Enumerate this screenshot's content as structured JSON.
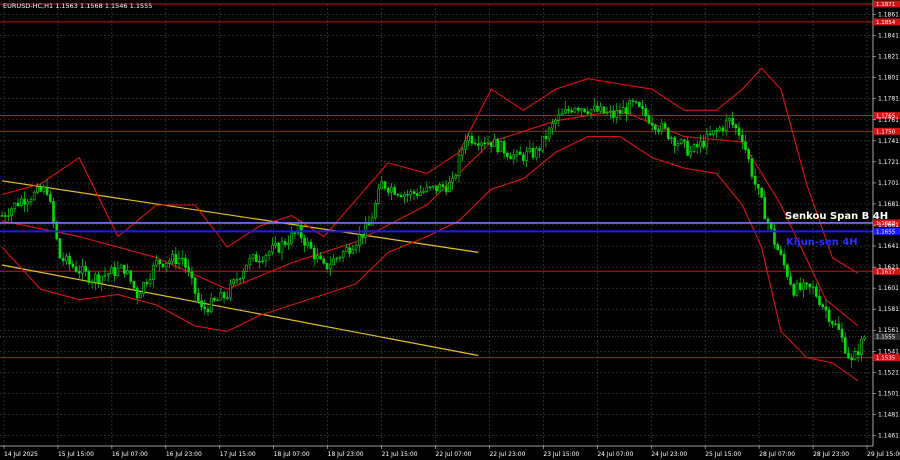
{
  "header": {
    "symbol_line": "EURUSD-HC,H1 1.1563 1.1568 1.1546 1.1555"
  },
  "annotations": {
    "senkou": "Senkou Span B 4H",
    "kijun": "Kijun-sen 4H"
  },
  "colors": {
    "background": "#000000",
    "grid": "#4a4a4a",
    "bull_candle": "#00e000",
    "bear_candle": "#00e000",
    "bollinger": "#e01010",
    "level_line": "#c01818",
    "channel": "#e8c020",
    "senkou": "#7a7aff",
    "kijun": "#1a1aff",
    "current_badge": "#303030"
  },
  "chart_data": {
    "type": "candlestick",
    "symbol": "EURUSD-HC",
    "timeframe": "H1",
    "ylim": [
      1.1451,
      1.1871
    ],
    "price_ticks": [
      "1.1861",
      "1.1841",
      "1.1821",
      "1.1801",
      "1.1781",
      "1.1761",
      "1.1741",
      "1.1721",
      "1.1701",
      "1.1681",
      "1.1661",
      "1.1641",
      "1.1621",
      "1.1601",
      "1.1581",
      "1.1561",
      "1.1541",
      "1.1521",
      "1.1501",
      "1.1481",
      "1.1461"
    ],
    "time_ticks": [
      "14 Jul 2025",
      "15 Jul 15:00",
      "16 Jul 07:00",
      "16 Jul 23:00",
      "17 Jul 15:00",
      "18 Jul 07:00",
      "18 Jul 23:00",
      "21 Jul 15:00",
      "22 Jul 07:00",
      "22 Jul 23:00",
      "23 Jul 15:00",
      "24 Jul 07:00",
      "24 Jul 23:00",
      "25 Jul 15:00",
      "28 Jul 07:00",
      "28 Jul 23:00",
      "29 Jul 15:00"
    ],
    "horizontal_levels": [
      {
        "price": 1.1871,
        "label": "1.1871"
      },
      {
        "price": 1.1854,
        "label": "1.1854"
      },
      {
        "price": 1.1765,
        "label": "1.1765"
      },
      {
        "price": 1.175,
        "label": "1.1750"
      },
      {
        "price": 1.1617,
        "label": "1.1617"
      },
      {
        "price": 1.1535,
        "label": "1.1535"
      }
    ],
    "senkou_span_b": {
      "price": 1.1663,
      "label": "1.1663"
    },
    "kijun_sen": {
      "price": 1.1655,
      "label": "1.1655"
    },
    "current_price": {
      "price": 1.1555,
      "label": "1.1555"
    },
    "channel_upper": [
      {
        "x": 0,
        "y": 1.1703
      },
      {
        "x": 148,
        "y": 1.1635
      }
    ],
    "channel_lower": [
      {
        "x": 0,
        "y": 1.1623
      },
      {
        "x": 148,
        "y": 1.1537
      }
    ],
    "close_path": [
      {
        "x": 0,
        "y": 1.167
      },
      {
        "x": 6,
        "y": 1.1685
      },
      {
        "x": 14,
        "y": 1.1695
      },
      {
        "x": 18,
        "y": 1.163
      },
      {
        "x": 28,
        "y": 1.161
      },
      {
        "x": 38,
        "y": 1.162
      },
      {
        "x": 42,
        "y": 1.1595
      },
      {
        "x": 48,
        "y": 1.1625
      },
      {
        "x": 56,
        "y": 1.163
      },
      {
        "x": 62,
        "y": 1.158
      },
      {
        "x": 70,
        "y": 1.1595
      },
      {
        "x": 76,
        "y": 1.1625
      },
      {
        "x": 86,
        "y": 1.164
      },
      {
        "x": 92,
        "y": 1.1655
      },
      {
        "x": 100,
        "y": 1.162
      },
      {
        "x": 108,
        "y": 1.164
      },
      {
        "x": 114,
        "y": 1.166
      },
      {
        "x": 118,
        "y": 1.17
      },
      {
        "x": 126,
        "y": 1.169
      },
      {
        "x": 134,
        "y": 1.1695
      },
      {
        "x": 140,
        "y": 1.17
      },
      {
        "x": 144,
        "y": 1.1745
      },
      {
        "x": 152,
        "y": 1.174
      },
      {
        "x": 160,
        "y": 1.1725
      },
      {
        "x": 166,
        "y": 1.173
      },
      {
        "x": 172,
        "y": 1.176
      },
      {
        "x": 178,
        "y": 1.1775
      },
      {
        "x": 184,
        "y": 1.177
      },
      {
        "x": 190,
        "y": 1.1765
      },
      {
        "x": 196,
        "y": 1.1775
      },
      {
        "x": 202,
        "y": 1.176
      },
      {
        "x": 208,
        "y": 1.1745
      },
      {
        "x": 214,
        "y": 1.173
      },
      {
        "x": 220,
        "y": 1.1745
      },
      {
        "x": 226,
        "y": 1.176
      },
      {
        "x": 230,
        "y": 1.1745
      },
      {
        "x": 234,
        "y": 1.17
      },
      {
        "x": 240,
        "y": 1.1645
      },
      {
        "x": 246,
        "y": 1.16
      },
      {
        "x": 252,
        "y": 1.16
      },
      {
        "x": 256,
        "y": 1.158
      },
      {
        "x": 260,
        "y": 1.156
      },
      {
        "x": 264,
        "y": 1.153
      },
      {
        "x": 268,
        "y": 1.1555
      }
    ],
    "bollinger_upper": [
      {
        "x": 0,
        "y": 1.169
      },
      {
        "x": 12,
        "y": 1.17
      },
      {
        "x": 24,
        "y": 1.1725
      },
      {
        "x": 36,
        "y": 1.165
      },
      {
        "x": 48,
        "y": 1.168
      },
      {
        "x": 60,
        "y": 1.168
      },
      {
        "x": 70,
        "y": 1.164
      },
      {
        "x": 80,
        "y": 1.166
      },
      {
        "x": 90,
        "y": 1.167
      },
      {
        "x": 100,
        "y": 1.165
      },
      {
        "x": 110,
        "y": 1.1685
      },
      {
        "x": 120,
        "y": 1.172
      },
      {
        "x": 132,
        "y": 1.171
      },
      {
        "x": 142,
        "y": 1.173
      },
      {
        "x": 152,
        "y": 1.179
      },
      {
        "x": 162,
        "y": 1.177
      },
      {
        "x": 172,
        "y": 1.179
      },
      {
        "x": 182,
        "y": 1.18
      },
      {
        "x": 192,
        "y": 1.1795
      },
      {
        "x": 202,
        "y": 1.179
      },
      {
        "x": 212,
        "y": 1.177
      },
      {
        "x": 222,
        "y": 1.177
      },
      {
        "x": 230,
        "y": 1.179
      },
      {
        "x": 236,
        "y": 1.181
      },
      {
        "x": 242,
        "y": 1.179
      },
      {
        "x": 250,
        "y": 1.17
      },
      {
        "x": 258,
        "y": 1.163
      },
      {
        "x": 266,
        "y": 1.1615
      }
    ],
    "bollinger_lower": [
      {
        "x": 0,
        "y": 1.164
      },
      {
        "x": 12,
        "y": 1.16
      },
      {
        "x": 24,
        "y": 1.159
      },
      {
        "x": 36,
        "y": 1.1595
      },
      {
        "x": 48,
        "y": 1.1585
      },
      {
        "x": 60,
        "y": 1.1565
      },
      {
        "x": 70,
        "y": 1.156
      },
      {
        "x": 80,
        "y": 1.1575
      },
      {
        "x": 90,
        "y": 1.1585
      },
      {
        "x": 100,
        "y": 1.1595
      },
      {
        "x": 110,
        "y": 1.1605
      },
      {
        "x": 120,
        "y": 1.1635
      },
      {
        "x": 132,
        "y": 1.165
      },
      {
        "x": 142,
        "y": 1.1665
      },
      {
        "x": 152,
        "y": 1.1695
      },
      {
        "x": 162,
        "y": 1.1705
      },
      {
        "x": 172,
        "y": 1.173
      },
      {
        "x": 182,
        "y": 1.1745
      },
      {
        "x": 192,
        "y": 1.1745
      },
      {
        "x": 202,
        "y": 1.1725
      },
      {
        "x": 212,
        "y": 1.1715
      },
      {
        "x": 222,
        "y": 1.171
      },
      {
        "x": 230,
        "y": 1.168
      },
      {
        "x": 236,
        "y": 1.164
      },
      {
        "x": 242,
        "y": 1.156
      },
      {
        "x": 250,
        "y": 1.1535
      },
      {
        "x": 258,
        "y": 1.153
      },
      {
        "x": 266,
        "y": 1.1513
      }
    ],
    "bollinger_mid": [
      {
        "x": 0,
        "y": 1.1665
      },
      {
        "x": 24,
        "y": 1.165
      },
      {
        "x": 48,
        "y": 1.163
      },
      {
        "x": 70,
        "y": 1.16
      },
      {
        "x": 90,
        "y": 1.1625
      },
      {
        "x": 110,
        "y": 1.1645
      },
      {
        "x": 132,
        "y": 1.168
      },
      {
        "x": 152,
        "y": 1.174
      },
      {
        "x": 172,
        "y": 1.176
      },
      {
        "x": 192,
        "y": 1.177
      },
      {
        "x": 212,
        "y": 1.1745
      },
      {
        "x": 230,
        "y": 1.174
      },
      {
        "x": 242,
        "y": 1.168
      },
      {
        "x": 256,
        "y": 1.159
      },
      {
        "x": 266,
        "y": 1.1565
      }
    ]
  }
}
